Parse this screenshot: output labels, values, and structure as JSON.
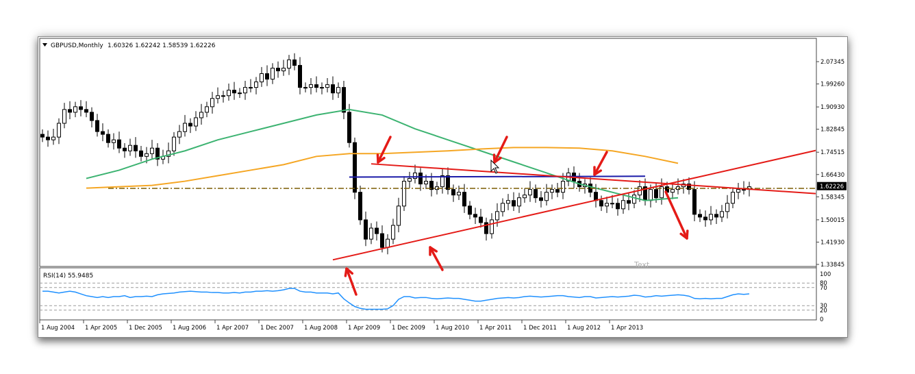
{
  "header": {
    "symbol": "GBPUSD,Monthly",
    "ohlc": "1.60326 1.62242 1.58539 1.62226"
  },
  "annotation_text": "Text",
  "colors": {
    "up_candle": "#ffffff",
    "down_candle": "#000000",
    "ma_green": "#3cb371",
    "ma_orange": "#f5a623",
    "resistance_blue": "#1a1aa8",
    "trend_red": "#e41b17",
    "arrow_red": "#e41b17",
    "rsi_line": "#1e90ff",
    "dashed_level": "#7a5c00",
    "price_tag_bg": "#000000"
  },
  "chart_data": [
    {
      "type": "candlestick",
      "title": "GBPUSD,Monthly",
      "ylim": [
        1.3,
        2.14
      ],
      "price_ticks": [
        "2.07345",
        "1.99260",
        "1.90930",
        "1.82845",
        "1.74515",
        "1.66430",
        "1.58345",
        "1.50015",
        "1.41930",
        "1.33845"
      ],
      "current_price": "1.62226",
      "x_labels": [
        "1 Aug 2004",
        "1 Apr 2005",
        "1 Dec 2005",
        "1 Aug 2006",
        "1 Apr 2007",
        "1 Dec 2007",
        "1 Aug 2008",
        "1 Apr 2009",
        "1 Dec 2009",
        "1 Aug 2010",
        "1 Apr 2011",
        "1 Dec 2011",
        "1 Aug 2012",
        "1 Apr 2013"
      ],
      "series": [
        {
          "name": "close",
          "values": [
            1.8,
            1.79,
            1.8,
            1.85,
            1.9,
            1.89,
            1.91,
            1.9,
            1.89,
            1.86,
            1.82,
            1.81,
            1.78,
            1.79,
            1.76,
            1.75,
            1.77,
            1.75,
            1.73,
            1.74,
            1.76,
            1.72,
            1.73,
            1.75,
            1.8,
            1.82,
            1.85,
            1.84,
            1.87,
            1.89,
            1.91,
            1.94,
            1.95,
            1.95,
            1.97,
            1.96,
            1.96,
            1.98,
            1.98,
            2.0,
            2.03,
            2.01,
            2.05,
            2.04,
            2.05,
            2.08,
            2.06,
            1.98,
            1.98,
            1.99,
            1.98,
            1.98,
            1.99,
            1.96,
            1.98,
            1.89,
            1.78,
            1.6,
            1.5,
            1.43,
            1.47,
            1.45,
            1.4,
            1.43,
            1.48,
            1.55,
            1.64,
            1.65,
            1.67,
            1.63,
            1.64,
            1.61,
            1.62,
            1.66,
            1.61,
            1.59,
            1.6,
            1.55,
            1.52,
            1.51,
            1.49,
            1.45,
            1.5,
            1.53,
            1.56,
            1.57,
            1.55,
            1.58,
            1.59,
            1.61,
            1.58,
            1.57,
            1.6,
            1.61,
            1.6,
            1.64,
            1.67,
            1.64,
            1.62,
            1.63,
            1.6,
            1.57,
            1.55,
            1.56,
            1.56,
            1.54,
            1.57,
            1.56,
            1.59,
            1.62,
            1.57,
            1.61,
            1.58,
            1.62,
            1.6,
            1.61,
            1.62,
            1.63,
            1.61,
            1.52,
            1.51,
            1.5,
            1.52,
            1.51,
            1.53,
            1.56,
            1.6,
            1.61,
            1.61,
            1.62
          ]
        },
        {
          "name": "moving_average_green",
          "x_start_index": 8,
          "values": [
            1.65,
            1.68,
            1.72,
            1.75,
            1.79,
            1.82,
            1.85,
            1.88,
            1.9,
            1.88,
            1.83,
            1.79,
            1.75,
            1.71,
            1.67,
            1.63,
            1.6,
            1.57,
            1.58
          ]
        },
        {
          "name": "moving_average_orange",
          "x_start_index": 8,
          "values": [
            1.615,
            1.62,
            1.625,
            1.64,
            1.66,
            1.68,
            1.7,
            1.73,
            1.74,
            1.74,
            1.745,
            1.75,
            1.757,
            1.762,
            1.762,
            1.76,
            1.75,
            1.73,
            1.705
          ]
        },
        {
          "name": "rsi_14",
          "values": [
            62,
            62,
            60,
            58,
            60,
            62,
            60,
            56,
            52,
            50,
            48,
            50,
            48,
            50,
            50,
            52,
            48,
            50,
            50,
            51,
            50,
            54,
            56,
            57,
            58,
            60,
            61,
            62,
            61,
            60,
            60,
            59,
            59,
            58,
            58,
            59,
            58,
            60,
            60,
            62,
            62,
            63,
            62,
            63,
            65,
            68,
            68,
            62,
            60,
            60,
            58,
            58,
            58,
            56,
            58,
            45,
            36,
            28,
            24,
            22,
            22,
            22,
            22,
            23,
            30,
            44,
            50,
            50,
            47,
            48,
            48,
            46,
            45,
            46,
            47,
            46,
            46,
            44,
            42,
            40,
            40,
            42,
            44,
            46,
            47,
            48,
            47,
            48,
            50,
            51,
            50,
            49,
            50,
            51,
            52,
            52,
            50,
            49,
            48,
            50,
            50,
            47,
            48,
            49,
            50,
            49,
            50,
            51,
            53,
            52,
            49,
            50,
            52,
            51,
            52,
            53,
            54,
            53,
            51,
            46,
            45,
            46,
            45,
            46,
            46,
            50,
            54,
            56,
            55,
            56
          ]
        }
      ],
      "rsi_label": "RSI(14) 55.9485",
      "rsi_ticks": [
        "100",
        "80",
        "70",
        "30",
        "20",
        "0"
      ]
    }
  ]
}
